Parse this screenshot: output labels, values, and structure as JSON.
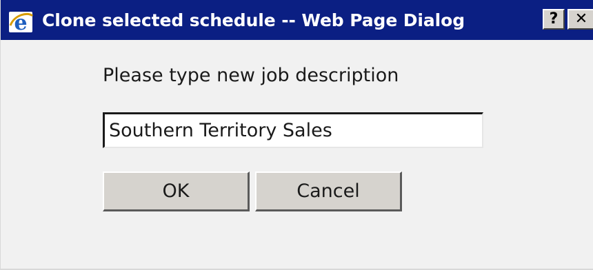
{
  "window": {
    "title": "Clone selected schedule -- Web Page Dialog",
    "title_icon": "ie-icon",
    "help_label": "?",
    "close_label": "✕",
    "colors": {
      "titlebar": "#0b1f83",
      "dialog_bg": "#f1f1f1",
      "button_face": "#d6d3ce"
    }
  },
  "form": {
    "prompt": "Please type new job description",
    "job_description_value": "Southern Territory Sales",
    "ok_label": "OK",
    "cancel_label": "Cancel"
  }
}
